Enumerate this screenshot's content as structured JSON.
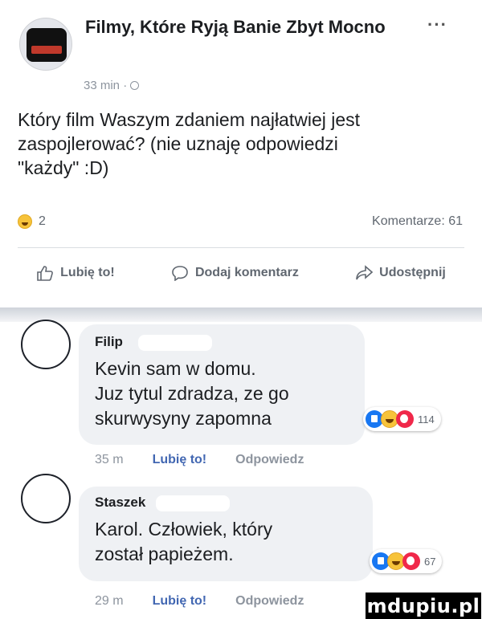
{
  "post": {
    "page_name": "Filmy, Które Ryją Banie Zbyt Mocno",
    "time": "33 min ·",
    "more": "···",
    "text": "Który film Waszym zdaniem najłatwiej jest\nzaspojlerować? (nie uznaję odpowiedzi\n\"każdy\" :D)",
    "reaction_count": "2",
    "comments_label": "Komentarze: 61"
  },
  "actions": {
    "like": "Lubię to!",
    "comment": "Dodaj komentarz",
    "share": "Udostępnij"
  },
  "comments": [
    {
      "author": "Filip",
      "text": "Kevin sam w domu.\nJuz tytul zdradza, ze go\nskurwysyny zapomna",
      "reactions": "114",
      "time": "35 m",
      "like": "Lubię to!",
      "reply": "Odpowiedz"
    },
    {
      "author": "Staszek",
      "text": "Karol. Człowiek, który\nzostał papieżem.",
      "reactions": "67",
      "time": "29 m",
      "like": "Lubię to!",
      "reply": "Odpowiedz"
    }
  ],
  "watermark": "mdupiu.pl",
  "colors": {
    "link_blue": "#4267b2",
    "bubble": "#eff1f4",
    "muted": "#8d949e"
  },
  "icons": [
    "globe-icon",
    "haha-emoji-icon",
    "like-outline-icon",
    "comment-outline-icon",
    "share-outline-icon",
    "like-reaction-icon",
    "wow-reaction-icon"
  ]
}
